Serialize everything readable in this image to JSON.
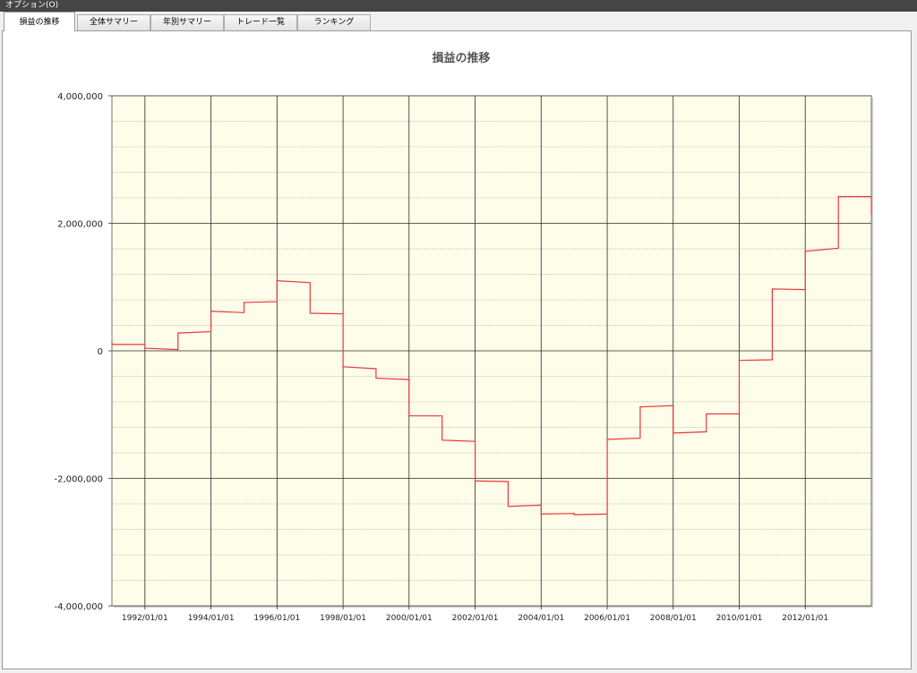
{
  "menu": {
    "options_label": "オプション(O)"
  },
  "tabs": [
    {
      "label": "損益の推移",
      "active": true
    },
    {
      "label": "全体サマリー",
      "active": false
    },
    {
      "label": "年別サマリー",
      "active": false
    },
    {
      "label": "トレード一覧",
      "active": false
    },
    {
      "label": "ランキング",
      "active": false
    }
  ],
  "colors": {
    "plot_background": "#fdfde9",
    "line": "#e8383c",
    "grid_major": "#2b2b2b",
    "grid_minor": "#a8a8a8",
    "menubar": "#454545"
  },
  "chart_data": {
    "type": "line",
    "title": "損益の推移",
    "xlabel": "",
    "ylabel": "",
    "xlim": [
      "1991/01/01",
      "2014/01/01"
    ],
    "ylim": [
      -4000000,
      4000000
    ],
    "y_ticks": [
      -4000000,
      -2000000,
      0,
      2000000,
      4000000
    ],
    "y_tick_labels": [
      "-4,000,000",
      "-2,000,000",
      "0",
      "2,000,000",
      "4,000,000"
    ],
    "x_ticks": [
      "1992/01/01",
      "1994/01/01",
      "1996/01/01",
      "1998/01/01",
      "2000/01/01",
      "2002/01/01",
      "2004/01/01",
      "2006/01/01",
      "2008/01/01",
      "2010/01/01",
      "2012/01/01"
    ],
    "minor_y_step": 400000,
    "grid": true,
    "legend": "none",
    "series": [
      {
        "x": [
          "1991/01/01",
          "1991/01/01",
          "1992/01/01",
          "1992/01/01",
          "1993/01/01",
          "1993/01/01",
          "1994/01/01",
          "1994/01/01",
          "1995/01/01",
          "1995/01/01",
          "1996/01/01",
          "1996/01/01",
          "1997/01/01",
          "1997/01/01",
          "1998/01/01",
          "1998/01/01",
          "1999/01/01",
          "1999/01/01",
          "2000/01/01",
          "2000/01/01",
          "2001/01/01",
          "2001/01/01",
          "2002/01/01",
          "2002/01/01",
          "2003/01/01",
          "2003/01/01",
          "2004/01/01",
          "2004/01/01",
          "2005/01/01",
          "2005/01/01",
          "2006/01/01",
          "2006/01/01",
          "2007/01/01",
          "2007/01/01",
          "2008/01/01",
          "2008/01/01",
          "2009/01/01",
          "2009/01/01",
          "2010/01/01",
          "2010/01/01",
          "2011/01/01",
          "2011/01/01",
          "2012/01/01",
          "2012/01/01",
          "2013/01/01",
          "2013/01/01",
          "2014/01/01",
          "2014/01/01"
        ],
        "y": [
          150000,
          100000,
          100000,
          40000,
          20000,
          280000,
          300000,
          620000,
          600000,
          760000,
          770000,
          1100000,
          1070000,
          590000,
          580000,
          -250000,
          -280000,
          -430000,
          -450000,
          -1020000,
          -1020000,
          -1400000,
          -1420000,
          -2040000,
          -2050000,
          -2440000,
          -2420000,
          -2560000,
          -2550000,
          -2570000,
          -2560000,
          -1390000,
          -1370000,
          -880000,
          -860000,
          -1290000,
          -1270000,
          -990000,
          -990000,
          -150000,
          -140000,
          970000,
          960000,
          1560000,
          1610000,
          2420000,
          2420000,
          2130000
        ]
      }
    ]
  }
}
